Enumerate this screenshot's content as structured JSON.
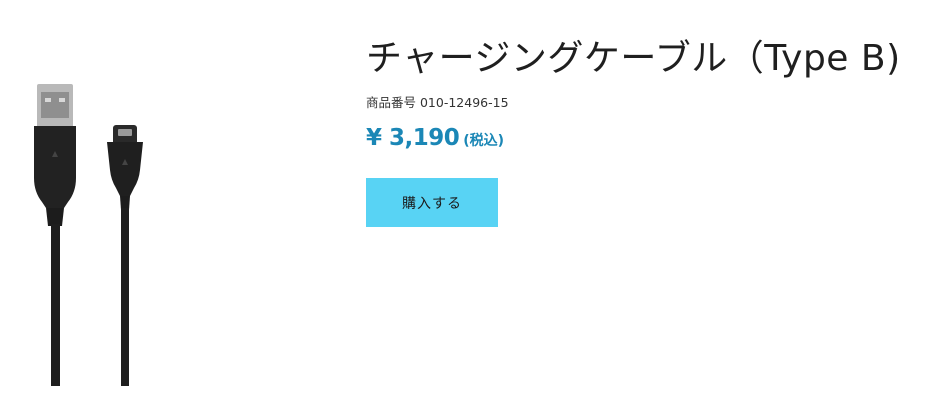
{
  "product": {
    "title": "チャージングケーブル（Type B)",
    "sku": "商品番号 010-12496-15",
    "price": "¥ 3,190",
    "tax_note": "(税込)",
    "buy_label": "購入する",
    "image_icon": "charging-cable-image"
  },
  "colors": {
    "price": "#1b87b6",
    "button": "#58d3f4",
    "cable": "#1c1c1c"
  }
}
